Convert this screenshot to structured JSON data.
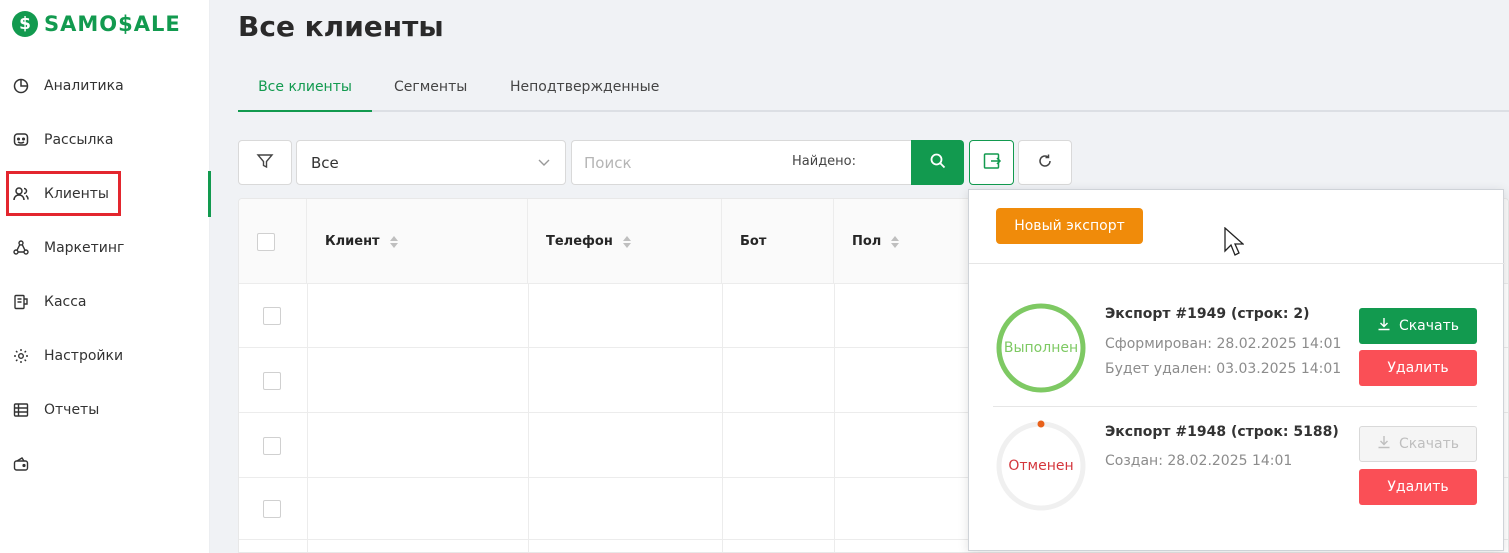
{
  "brand": {
    "logo_mark": "$",
    "logo_text": "SAMO$ALE",
    "color": "#129a4f"
  },
  "sidebar": {
    "items": [
      {
        "label": "Аналитика",
        "icon": "pie-chart-icon"
      },
      {
        "label": "Рассылка",
        "icon": "message-icon"
      },
      {
        "label": "Клиенты",
        "icon": "users-icon",
        "active": true
      },
      {
        "label": "Маркетинг",
        "icon": "network-icon"
      },
      {
        "label": "Касса",
        "icon": "register-icon"
      },
      {
        "label": "Настройки",
        "icon": "gear-icon"
      },
      {
        "label": "Отчеты",
        "icon": "table-icon"
      },
      {
        "label": "",
        "icon": "wallet-icon"
      }
    ]
  },
  "page": {
    "title": "Все клиенты"
  },
  "tabs": [
    {
      "label": "Все клиенты",
      "active": true
    },
    {
      "label": "Сегменты"
    },
    {
      "label": "Неподтвержденные"
    }
  ],
  "toolbar": {
    "filter_value": "Все",
    "search_placeholder": "Поиск",
    "found_label": "Найдено:"
  },
  "table": {
    "columns": [
      "Клиент",
      "Телефон",
      "Бот",
      "Пол"
    ]
  },
  "export_popup": {
    "new_export_label": "Новый экспорт",
    "exports": [
      {
        "title": "Экспорт #1949 (строк: 2)",
        "status": "Выполнен",
        "status_color": "#7ec963",
        "progress": 1.0,
        "meta": [
          "Сформирован: 28.02.2025 14:01",
          "Будет удален: 03.03.2025 14:01"
        ],
        "download_label": "Скачать",
        "download_enabled": true,
        "delete_label": "Удалить"
      },
      {
        "title": "Экспорт #1948 (строк: 5188)",
        "status": "Отменен",
        "status_color": "#d4363c",
        "progress": 0.0,
        "meta": [
          "Создан: 28.02.2025 14:01"
        ],
        "download_label": "Скачать",
        "download_enabled": false,
        "delete_label": "Удалить"
      }
    ]
  }
}
